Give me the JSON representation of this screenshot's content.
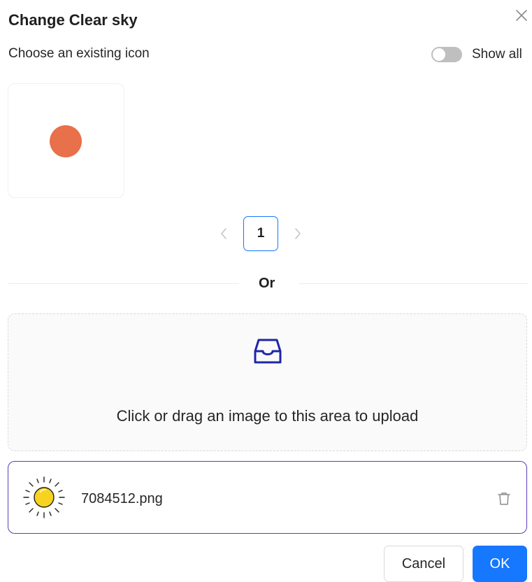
{
  "dialog": {
    "title": "Change Clear sky",
    "close_icon": "close-icon"
  },
  "icon_picker": {
    "label": "Choose an existing icon",
    "show_all_label": "Show all",
    "show_all_enabled": false,
    "icons": [
      {
        "color": "#e8704a",
        "name": "orange-circle-icon"
      }
    ]
  },
  "pagination": {
    "current_page": "1",
    "prev_icon": "chevron-left-icon",
    "next_icon": "chevron-right-icon"
  },
  "divider": {
    "label": "Or"
  },
  "upload": {
    "icon": "inbox-icon",
    "icon_color": "#1f26a8",
    "hint": "Click or drag an image to this area to upload"
  },
  "file": {
    "name": "7084512.png",
    "thumbnail_icon": "sun-icon",
    "delete_icon": "trash-icon"
  },
  "footer": {
    "cancel_label": "Cancel",
    "ok_label": "OK"
  },
  "colors": {
    "primary": "#1677ff",
    "file_border": "#5b3fb8",
    "sun_fill": "#f7d31f"
  }
}
